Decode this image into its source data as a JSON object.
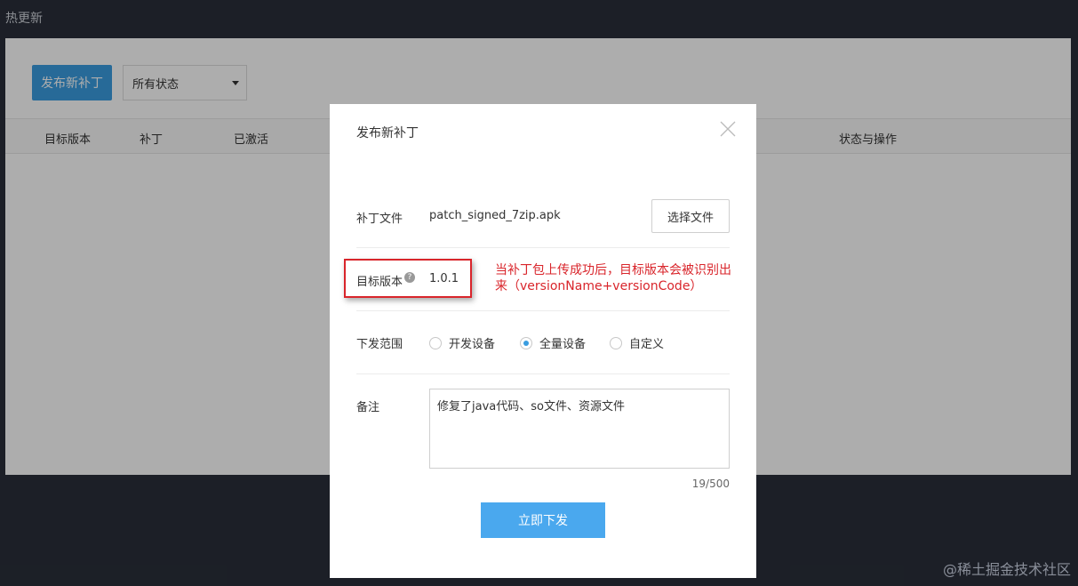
{
  "app": {
    "title": "热更新"
  },
  "toolbar": {
    "publish_label": "发布新补丁",
    "status_select": "所有状态"
  },
  "table": {
    "headers": [
      "目标版本",
      "补丁",
      "已激活",
      "状态与操作"
    ]
  },
  "modal": {
    "title": "发布新补丁",
    "patch_file": {
      "label": "补丁文件",
      "filename": "patch_signed_7zip.apk",
      "choose_label": "选择文件"
    },
    "target_version": {
      "label": "目标版本",
      "value": "1.0.1",
      "help": "?"
    },
    "annotation": "当补丁包上传成功后，目标版本会被识别出来（versionName+versionCode）",
    "scope": {
      "label": "下发范围",
      "options": [
        "开发设备",
        "全量设备",
        "自定义"
      ],
      "selected": "全量设备"
    },
    "notes": {
      "label": "备注",
      "value": "修复了java代码、so文件、资源文件",
      "counter": "19/500"
    },
    "submit_label": "立即下发"
  },
  "watermark": "@稀土掘金技术社区",
  "colors": {
    "accent": "#3a9de0",
    "annotation": "#d9252b"
  }
}
